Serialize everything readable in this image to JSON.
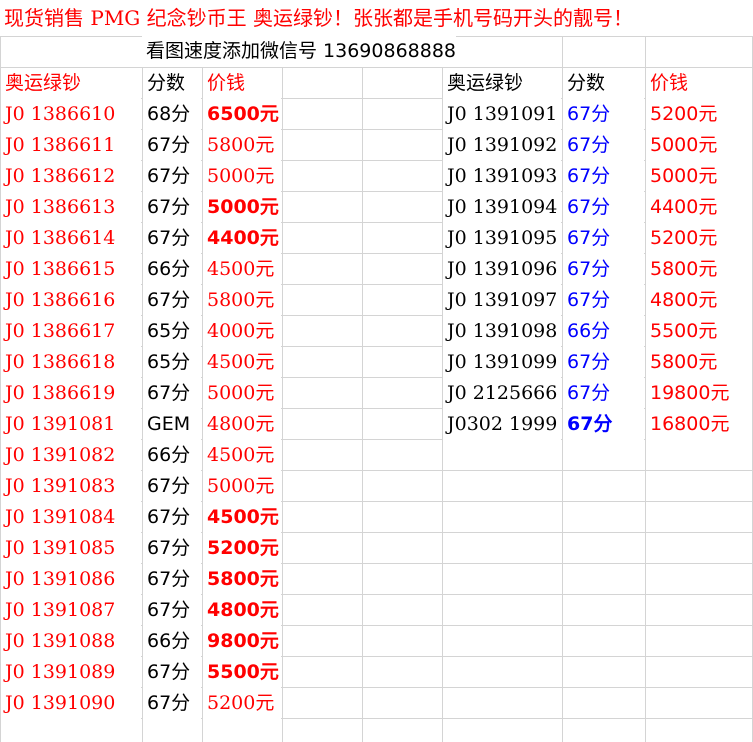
{
  "title": "现货销售 PMG 纪念钞币王 奥运绿钞！张张都是手机号码开头的靓号！",
  "contact": "看图速度添加微信号 13690868888",
  "left_table": {
    "headers": {
      "serial": "奥运绿钞",
      "grade": "分数",
      "price": "价钱"
    },
    "rows": [
      {
        "serial": "J0 1386610",
        "grade": "68分",
        "price": "6500元"
      },
      {
        "serial": "J0 1386611",
        "grade": "67分",
        "price": "5800元"
      },
      {
        "serial": "J0 1386612",
        "grade": "67分",
        "price": "5000元"
      },
      {
        "serial": "J0 1386613",
        "grade": "67分",
        "price": "5000元"
      },
      {
        "serial": "J0 1386614",
        "grade": "67分",
        "price": "4400元"
      },
      {
        "serial": "J0 1386615",
        "grade": "66分",
        "price": "4500元"
      },
      {
        "serial": "J0 1386616",
        "grade": "67分",
        "price": "5800元"
      },
      {
        "serial": "J0 1386617",
        "grade": "65分",
        "price": "4000元"
      },
      {
        "serial": "J0 1386618",
        "grade": "65分",
        "price": "4500元"
      },
      {
        "serial": "J0 1386619",
        "grade": "67分",
        "price": "5000元"
      },
      {
        "serial": "J0 1391081",
        "grade": "GEM",
        "price": "4800元"
      },
      {
        "serial": "J0 1391082",
        "grade": "66分",
        "price": "4500元"
      },
      {
        "serial": "J0 1391083",
        "grade": "67分",
        "price": "5000元"
      },
      {
        "serial": "J0 1391084",
        "grade": "67分",
        "price": "4500元"
      },
      {
        "serial": "J0 1391085",
        "grade": "67分",
        "price": "5200元"
      },
      {
        "serial": "J0 1391086",
        "grade": "67分",
        "price": "5800元"
      },
      {
        "serial": "J0 1391087",
        "grade": "67分",
        "price": "4800元"
      },
      {
        "serial": "J0 1391088",
        "grade": "66分",
        "price": "9800元"
      },
      {
        "serial": "J0 1391089",
        "grade": "67分",
        "price": "5500元"
      },
      {
        "serial": "J0 1391090",
        "grade": "67分",
        "price": "5200元"
      }
    ]
  },
  "right_table": {
    "headers": {
      "serial": "奥运绿钞",
      "grade": "分数",
      "price": "价钱"
    },
    "rows": [
      {
        "serial": "J0 1391091",
        "grade": "67分",
        "price": "5200元"
      },
      {
        "serial": "J0 1391092",
        "grade": "67分",
        "price": "5000元"
      },
      {
        "serial": "J0 1391093",
        "grade": "67分",
        "price": "5000元"
      },
      {
        "serial": "J0 1391094",
        "grade": "67分",
        "price": "4400元"
      },
      {
        "serial": "J0 1391095",
        "grade": "67分",
        "price": "5200元"
      },
      {
        "serial": "J0 1391096",
        "grade": "67分",
        "price": "5800元"
      },
      {
        "serial": "J0 1391097",
        "grade": "67分",
        "price": "4800元"
      },
      {
        "serial": "J0 1391098",
        "grade": "66分",
        "price": "5500元"
      },
      {
        "serial": "J0 1391099",
        "grade": "67分",
        "price": "5800元"
      },
      {
        "serial": "J0 2125666",
        "grade": "67分",
        "price": "19800元"
      },
      {
        "serial": "J0302 1999",
        "grade": "67分",
        "price": "16800元"
      }
    ]
  },
  "colors": {
    "red": "#ff0000",
    "blue": "#0000ff",
    "black": "#000000",
    "grid": "#d4d4d4"
  }
}
